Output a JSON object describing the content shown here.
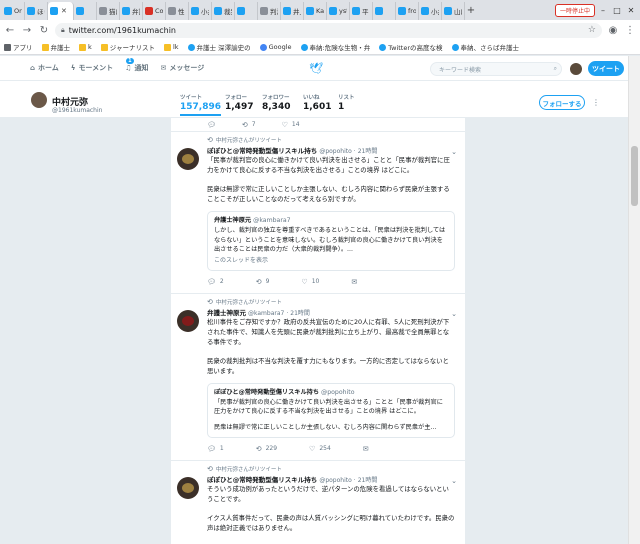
{
  "browser": {
    "tabs": [
      {
        "title": "On",
        "icon": "twitter-icon"
      },
      {
        "title": "ほり",
        "icon": "twitter-icon"
      },
      {
        "title": "",
        "icon": "twitter-icon",
        "active": true
      },
      {
        "title": "",
        "icon": "twitter-icon"
      },
      {
        "title": "猫に",
        "icon": "generic-icon"
      },
      {
        "title": "弁護",
        "icon": "twitter-icon"
      },
      {
        "title": "Co",
        "icon": "pdf-icon"
      },
      {
        "title": "性",
        "icon": "generic-icon"
      },
      {
        "title": "小井",
        "icon": "twitter-icon"
      },
      {
        "title": "裁判",
        "icon": "twitter-icon"
      },
      {
        "title": "",
        "icon": "twitter-icon"
      },
      {
        "title": "判決",
        "icon": "generic-icon"
      },
      {
        "title": "井上",
        "icon": "twitter-icon"
      },
      {
        "title": "Kaz",
        "icon": "twitter-icon"
      },
      {
        "title": "yst",
        "icon": "twitter-icon"
      },
      {
        "title": "平",
        "icon": "twitter-icon"
      },
      {
        "title": "",
        "icon": "twitter-icon"
      },
      {
        "title": "fro",
        "icon": "twitter-icon"
      },
      {
        "title": "小井",
        "icon": "twitter-icon"
      },
      {
        "title": "山口",
        "icon": "twitter-icon"
      }
    ],
    "pause_label": "一時停止中",
    "url": "twitter.com/1961kumachin",
    "bookmarks": [
      {
        "label": "アプリ",
        "kind": "apps"
      },
      {
        "label": "弁護士",
        "kind": "folder"
      },
      {
        "label": "k",
        "kind": "folder"
      },
      {
        "label": "ジャーナリスト",
        "kind": "folder"
      },
      {
        "label": "lk",
        "kind": "folder"
      },
      {
        "label": "弁護士 深澤諭史の",
        "kind": "twitter"
      },
      {
        "label": "Google",
        "kind": "google"
      },
      {
        "label": "奉納:危険な生物・弁",
        "kind": "twitter"
      },
      {
        "label": "Twitterの高度な検",
        "kind": "twitter"
      },
      {
        "label": "奉納、さらば弁護士",
        "kind": "twitter"
      }
    ]
  },
  "twitter_nav": {
    "home": "ホーム",
    "moments": "モーメント",
    "notifications": "通知",
    "notifications_badge": "1",
    "messages": "メッセージ",
    "search_placeholder": "キーワード検索",
    "tweet_button": "ツイート"
  },
  "profile": {
    "name": "中村元弥",
    "handle": "@1961kumachin",
    "stats": [
      {
        "label": "ツイート",
        "value": "157,896"
      },
      {
        "label": "フォロー",
        "value": "1,497"
      },
      {
        "label": "フォロワー",
        "value": "8,340"
      },
      {
        "label": "いいね",
        "value": "1,601"
      },
      {
        "label": "リスト",
        "value": "1"
      }
    ],
    "follow_button": "フォローする"
  },
  "timeline": {
    "top_actions": {
      "retweets": "7",
      "likes": "14"
    },
    "tweets": [
      {
        "retweeted_by": "中村元弥さんがリツイート",
        "name": "ぽぽひと@常時発動型傷リスキル持ち",
        "handle": "@popohito",
        "time": "21時間",
        "body": [
          "「民事が裁判官の良心に働きかけて良い判決を出させる」ことと「民事が裁判官に圧力をかけて良心に反する不当な判決を出させる」ことの境界 はどこに。",
          "民衆は無謬で常に正しいことしか主張しない、むしろ内容に関わらず民衆が主張することこそが正しいことなのだって考えなら別ですが。"
        ],
        "quote": {
          "name": "弁護士神原元",
          "handle": "@kambara7",
          "text": "しかし、裁判官の独立を尊重すべきであるということは、「民衆は判決を批判してはならない」ということを意味しない。むしろ裁判官の良心に働きかけて良い判決を出させることは民衆の力だ（大衆的裁判闘争）。...",
          "thread_link": "このスレッドを表示"
        },
        "replies": "2",
        "retweets": "9",
        "likes": "10"
      },
      {
        "retweeted_by": "中村元弥さんがリツイート",
        "name": "弁護士神原元",
        "handle": "@kambara7",
        "time": "21時間",
        "body": [
          "松川事件をご存知ですか？政府の反共宣伝のために20人に有罪、5人に死刑判決が下された事件で、知識人を先頭に民衆が裁判批判に立ち上がり、最高裁で全員無罪となる事件です。",
          "民衆の裁判批判は不当な判決を覆す力にもなります。一方的に否定してはならないと思います。"
        ],
        "quote": {
          "name": "ぽぽひと@常時発動型傷リスキル持ち",
          "handle": "@popohito",
          "text": "「民事が裁判官の良心に働きかけて良い判決を出させる」ことと「民事が裁判官に圧力をかけて良心に反する不当な判決を出させる」ことの境界 はどこに。",
          "text2": "民衆は無謬で常に正しいことしか主張しない、むしろ内容に関わらず民衆が主..."
        },
        "replies": "1",
        "retweets": "229",
        "likes": "254"
      },
      {
        "retweeted_by": "中村元弥さんがリツイート",
        "name": "ぽぽひと@常時発動型傷リスキル持ち",
        "handle": "@popohito",
        "time": "21時間",
        "body": [
          "そういう成功例があったというだけで、逆パターンの危険を看過してはならないということです。",
          "イクス人質事件だって、民衆の声は人質バッシングに明け暮れていたわけです。民衆の声は絶対正義ではありません。"
        ]
      }
    ]
  }
}
